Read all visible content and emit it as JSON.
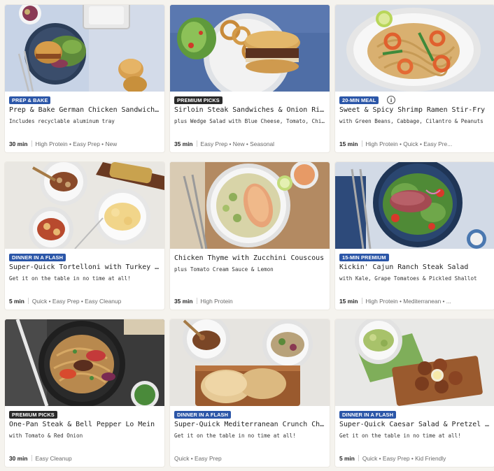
{
  "colors": {
    "badge_blue": "#2b56a8",
    "badge_dark": "#2a2a2a",
    "page_bg": "#f5f3ee",
    "card_bg": "#ffffff"
  },
  "recipes": [
    {
      "badge": "PREP & BAKE",
      "badge_color": "#2b56a8",
      "title": "Prep & Bake German Chicken Sandwiches",
      "subtitle": "Includes recyclable aluminum tray",
      "time": "30 min",
      "tags": "High Protein • Easy Prep • New",
      "image": "chicken-sandwiches-photo"
    },
    {
      "badge": "PREMIUM PICKS",
      "badge_color": "#2a2a2a",
      "title": "Sirloin Steak Sandwiches & Onion Rings",
      "subtitle": "plus Wedge Salad with Blue Cheese, Tomato, Chives...",
      "time": "35 min",
      "tags": "Easy Prep • New • Seasonal",
      "image": "steak-sandwich-photo"
    },
    {
      "badge": "20-MIN MEAL",
      "badge_color": "#2b56a8",
      "info_icon": "i",
      "title": "Sweet & Spicy Shrimp Ramen Stir-Fry",
      "subtitle": "with Green Beans, Cabbage, Cilantro & Peanuts",
      "time": "15 min",
      "tags": "High Protein • Quick • Easy Pre...",
      "image": "shrimp-ramen-photo"
    },
    {
      "badge": "DINNER IN A FLASH",
      "badge_color": "#2b56a8",
      "title": "Super-Quick Tortelloni with Turkey Bolo...",
      "subtitle": "Get it on the table in no time at all!",
      "time": "5 min",
      "tags": "Quick • Easy Prep • Easy Cleanup",
      "image": "tortelloni-photo"
    },
    {
      "badge": "",
      "badge_color": "",
      "title": "Chicken Thyme with Zucchini Couscous",
      "subtitle": "plus Tomato Cream Sauce & Lemon",
      "time": "35 min",
      "tags": "High Protein",
      "image": "couscous-bowl-photo"
    },
    {
      "badge": "15-MIN PREMIUM",
      "badge_color": "#2b56a8",
      "title": "Kickin' Cajun Ranch Steak Salad",
      "subtitle": "with Kale, Grape Tomatoes & Pickled Shallot",
      "time": "15 min",
      "tags": "High Protein • Mediterranean • ...",
      "image": "steak-salad-photo"
    },
    {
      "badge": "PREMIUM PICKS",
      "badge_color": "#2a2a2a",
      "title": "One-Pan Steak & Bell Pepper Lo Mein",
      "subtitle": "with Tomato & Red Onion",
      "time": "30 min",
      "tags": "Easy Cleanup",
      "image": "lo-mein-photo"
    },
    {
      "badge": "DINNER IN A FLASH",
      "badge_color": "#2b56a8",
      "title": "Super-Quick Mediterranean Crunch Chic...",
      "subtitle": "Get it on the table in no time at all!",
      "time": "",
      "tags": "Quick • Easy Prep",
      "image": "mediterranean-photo"
    },
    {
      "badge": "DINNER IN A FLASH",
      "badge_color": "#2b56a8",
      "title": "Super-Quick Caesar Salad & Pretzel Nu...",
      "subtitle": "Get it on the table in no time at all!",
      "time": "5 min",
      "tags": "Quick • Easy Prep • Kid Friendly",
      "image": "caesar-pretzel-photo"
    }
  ]
}
